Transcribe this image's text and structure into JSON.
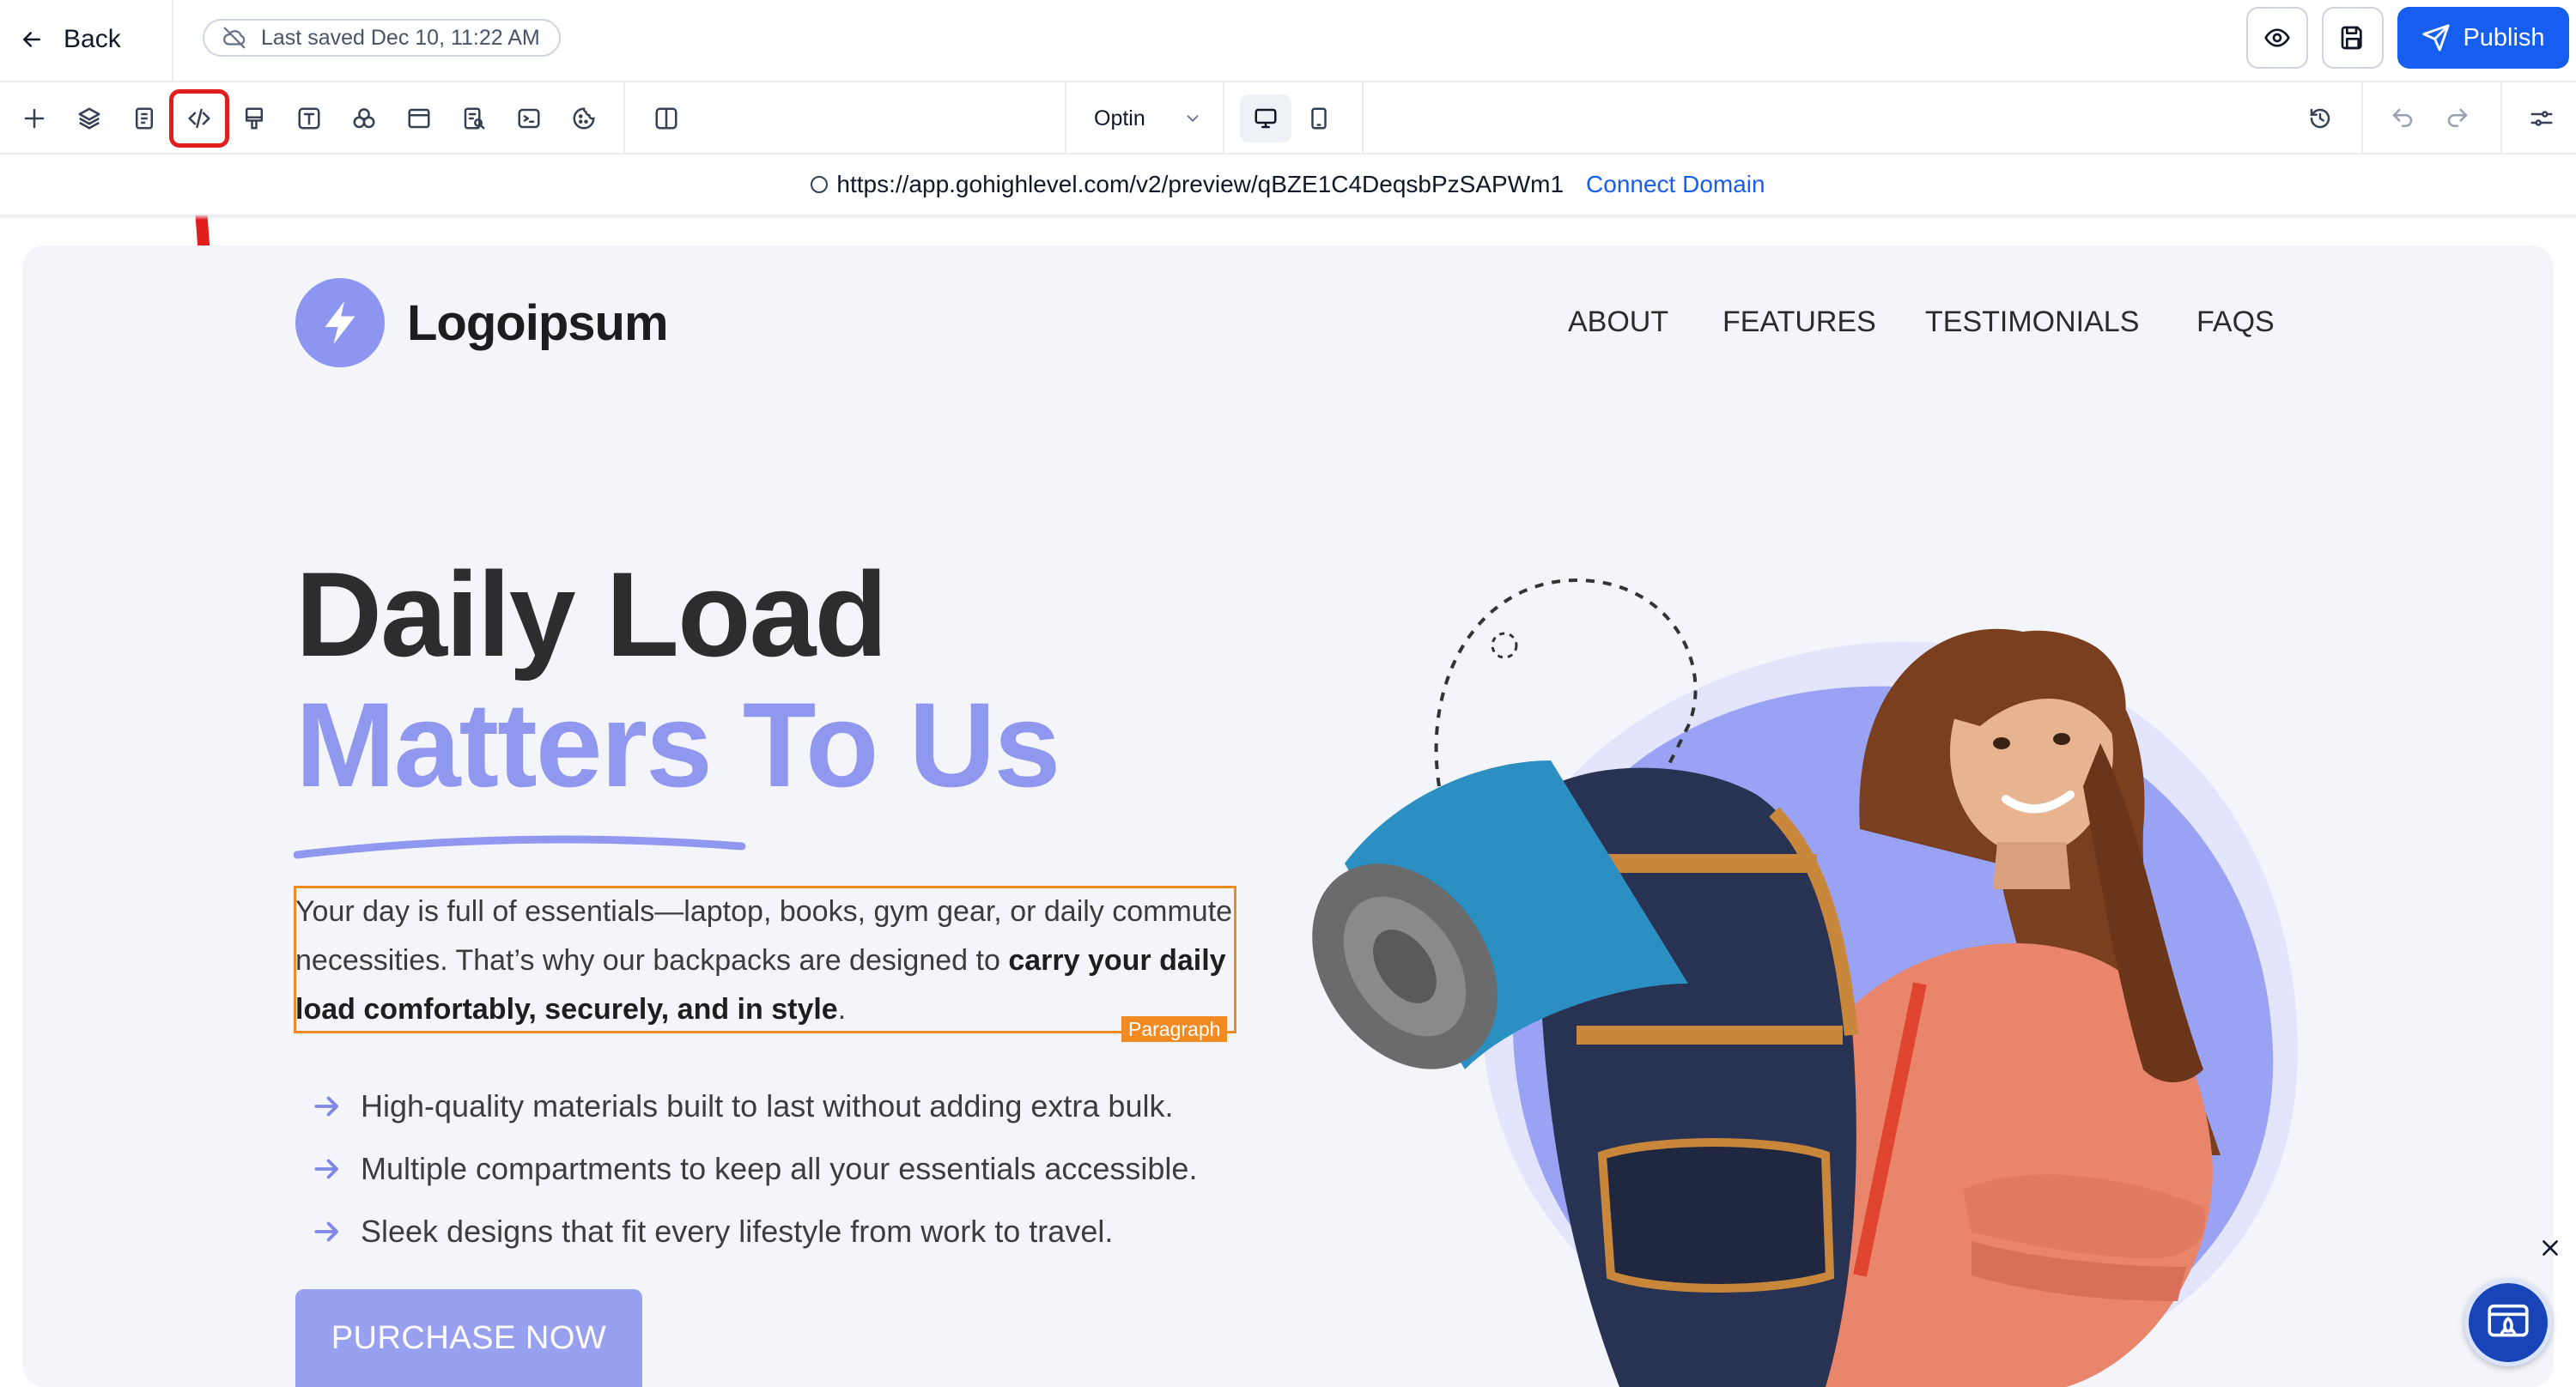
{
  "topbar": {
    "back_label": "Back",
    "saved_text": "Last saved Dec 10, 11:22 AM",
    "publish_label": "Publish"
  },
  "toolbar": {
    "icons": [
      "add-icon",
      "layers-icon",
      "pages-icon",
      "code-icon",
      "brush-icon",
      "text-icon",
      "elements-icon",
      "section-icon",
      "form-icon",
      "terminal-icon",
      "cookie-icon",
      "split-view-icon"
    ],
    "page_select_value": "Optin",
    "devices": [
      "desktop-icon",
      "mobile-icon"
    ],
    "right_icons": [
      "history-icon",
      "undo-icon",
      "redo-icon",
      "settings-sliders-icon"
    ]
  },
  "urlbar": {
    "url": "https://app.gohighlevel.com/v2/preview/qBZE1C4DeqsbPzSAPWm1",
    "connect_label": "Connect Domain"
  },
  "page": {
    "logo_text": "Logoipsum",
    "nav": [
      "ABOUT",
      "FEATURES",
      "TESTIMONIALS",
      "FAQS"
    ],
    "heading_line1": "Daily Load",
    "heading_line2": "Matters To Us",
    "paragraph_plain": "Your day is full of essentials—laptop, books, gym gear, or daily commute necessities. That’s why our backpacks are designed to ",
    "paragraph_bold": "carry your daily load comfortably, securely, and in style",
    "paragraph_end": ".",
    "paragraph_tag": "Paragraph",
    "bullets": [
      "High-quality materials built to last without adding extra bulk.",
      "Multiple compartments to keep all your essentials accessible.",
      "Sleek designs that fit every lifestyle from work to travel."
    ],
    "cta_label": "PURCHASE NOW"
  },
  "colors": {
    "accent": "#155eef",
    "brand_purple": "#8f98ee",
    "selection_orange": "#f28a24",
    "annotation_red": "#e11d1d"
  }
}
